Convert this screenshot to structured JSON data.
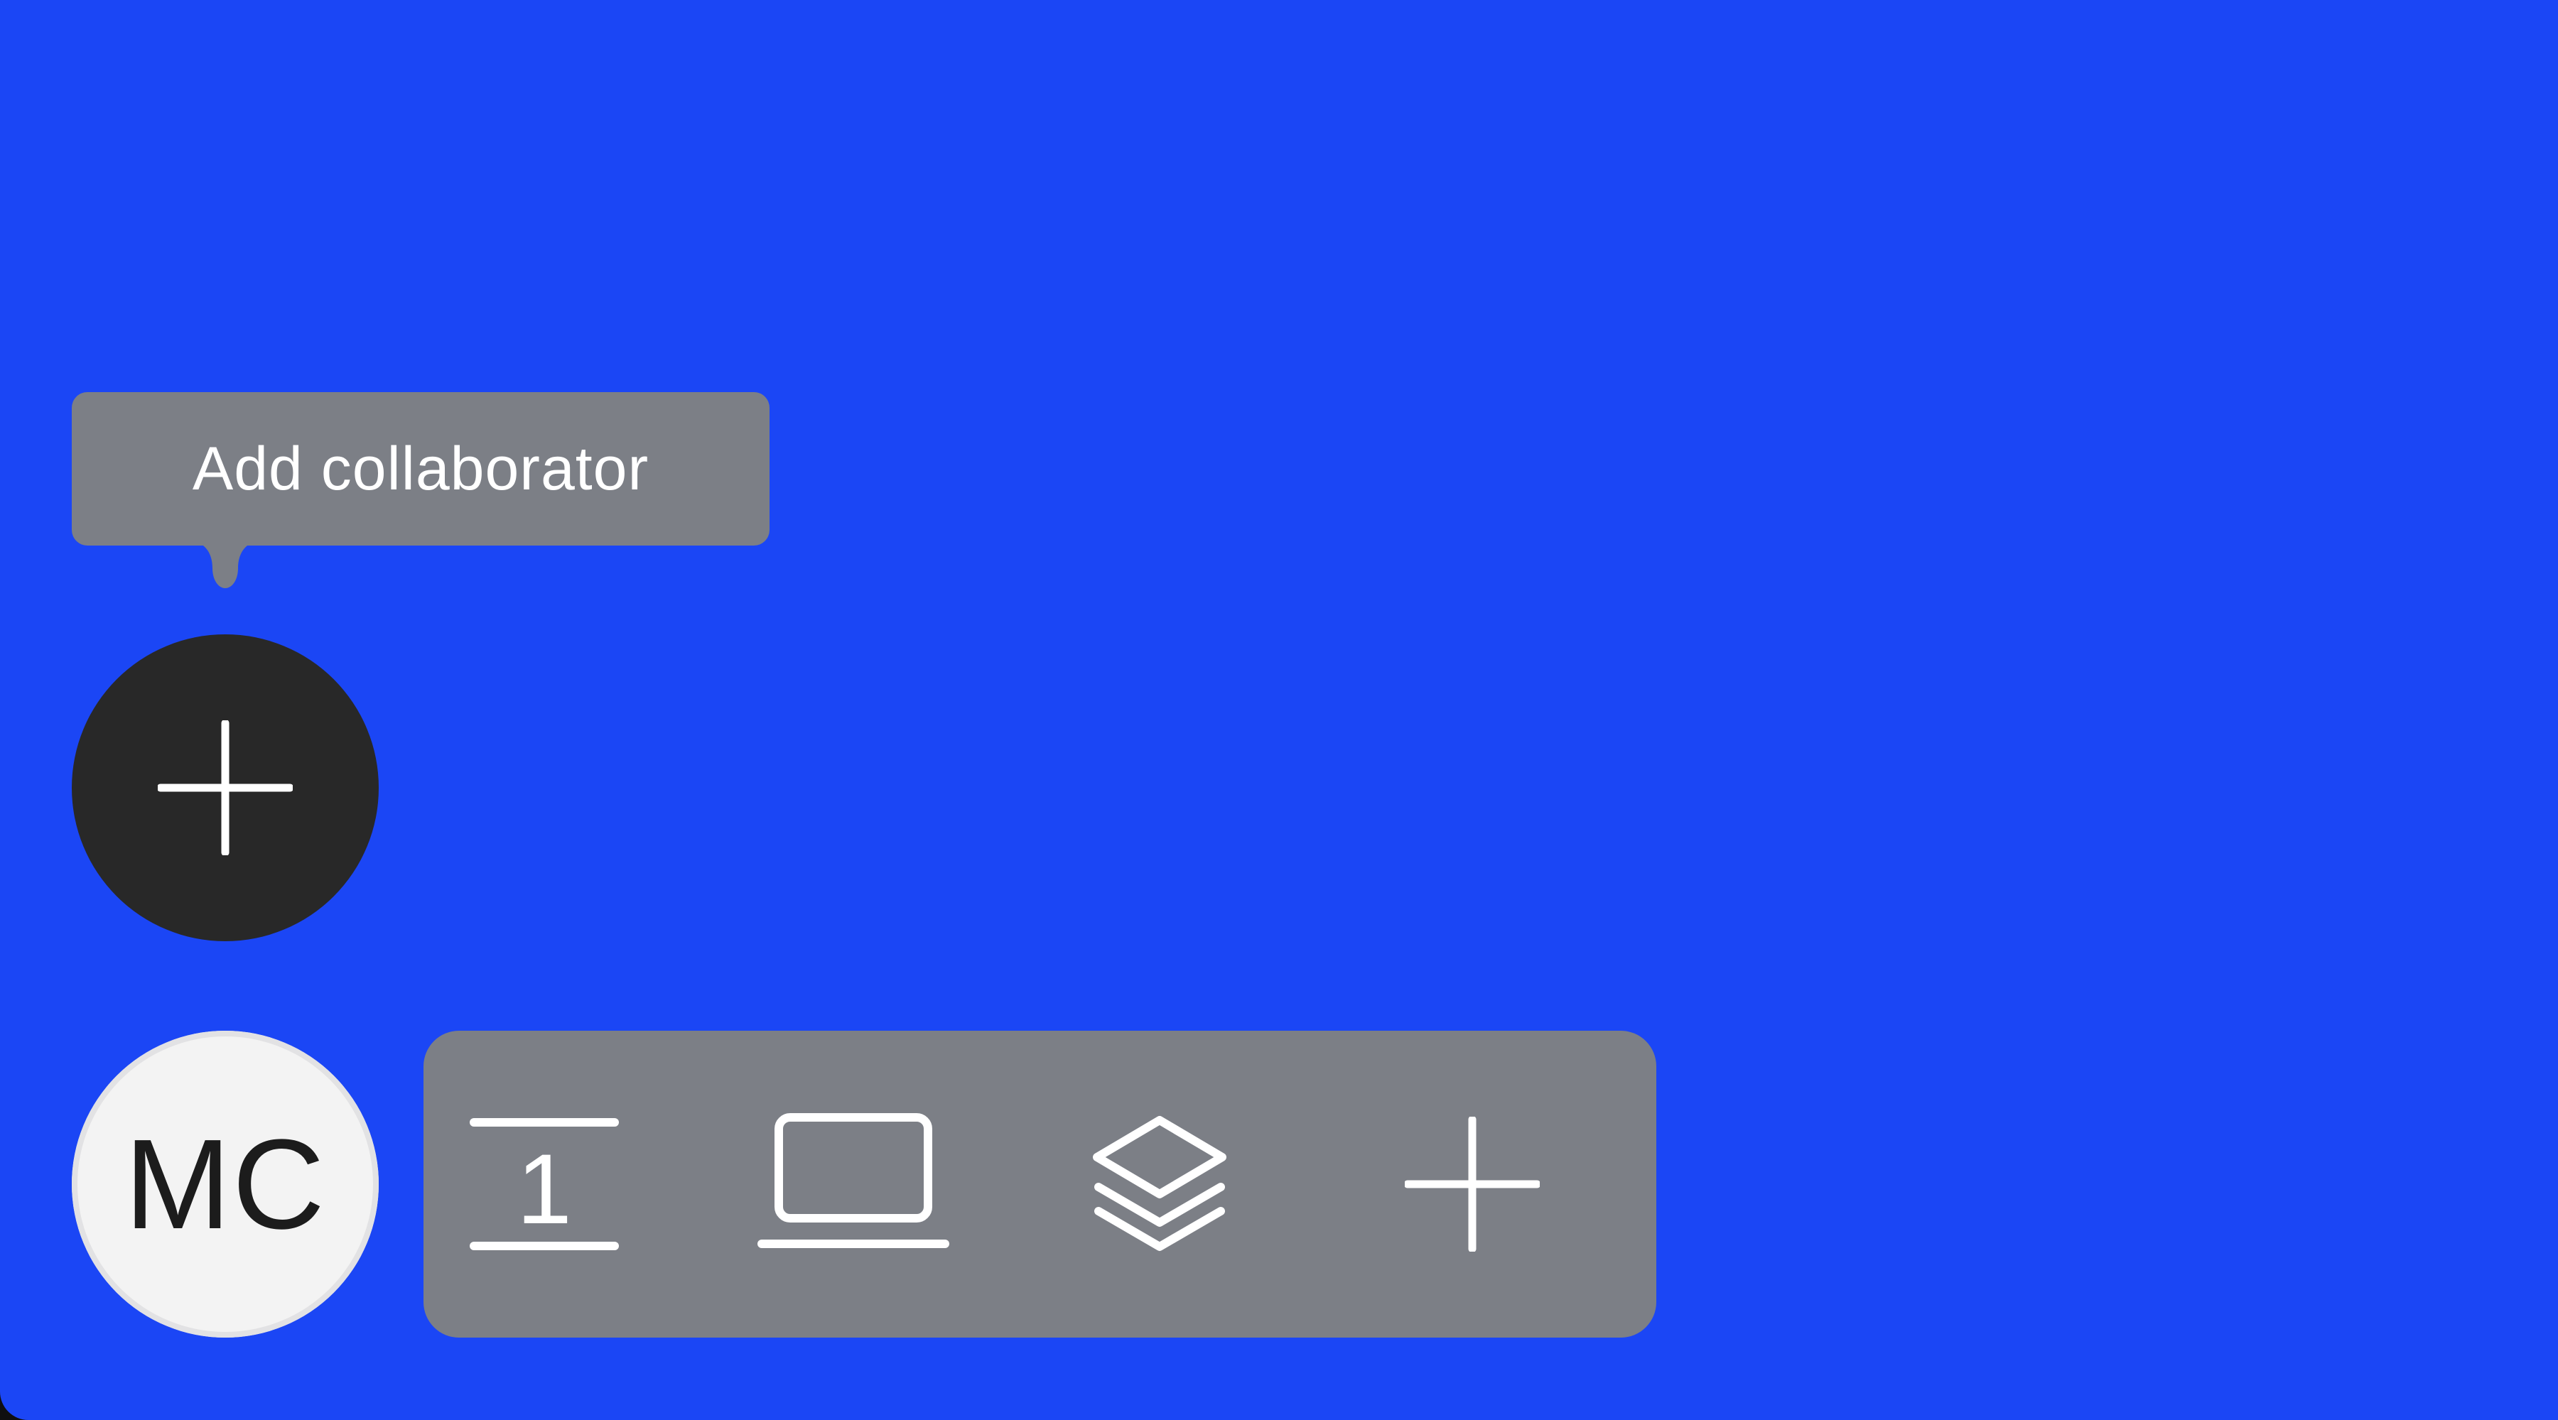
{
  "tooltip": {
    "text": "Add collaborator"
  },
  "add_collaborator_button": {
    "icon": "plus-icon"
  },
  "user_avatar": {
    "initials": "MC"
  },
  "toolbar": {
    "tools": [
      {
        "icon": "page-number-icon",
        "glyph": "1"
      },
      {
        "icon": "laptop-icon"
      },
      {
        "icon": "layers-icon"
      },
      {
        "icon": "plus-icon"
      }
    ]
  },
  "colors": {
    "canvas_background": "#1b46f5",
    "tooltip_background": "#7c7f86",
    "button_dark": "#282828",
    "avatar_background": "#f3f3f3",
    "icon_stroke": "#ffffff"
  }
}
